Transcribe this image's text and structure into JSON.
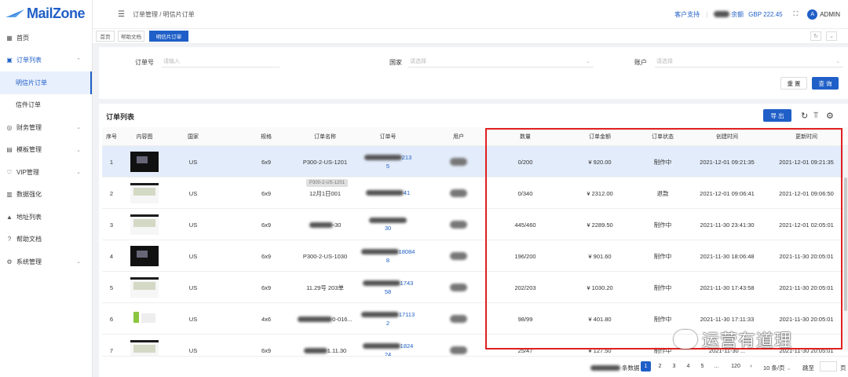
{
  "app": {
    "logo_text": "MailZone"
  },
  "sidebar": {
    "items": [
      {
        "icon": "grid-icon",
        "label": "首页",
        "chevron": false
      },
      {
        "icon": "calendar-icon",
        "label": "订单列表",
        "chevron": true,
        "open": true
      },
      {
        "icon": "none",
        "label": "明信片订单",
        "sub": true,
        "active": true
      },
      {
        "icon": "none",
        "label": "信件订单",
        "sub": true
      },
      {
        "icon": "dollar-icon",
        "label": "财务管理",
        "chevron": true
      },
      {
        "icon": "template-icon",
        "label": "模板管理",
        "chevron": true
      },
      {
        "icon": "vip-icon",
        "label": "VIP管理",
        "chevron": true
      },
      {
        "icon": "data-icon",
        "label": "数据强化",
        "chevron": false
      },
      {
        "icon": "address-icon",
        "label": "地址列表",
        "chevron": false
      },
      {
        "icon": "help-icon",
        "label": "帮助文档",
        "chevron": false
      },
      {
        "icon": "gear-icon",
        "label": "系统管理",
        "chevron": true
      }
    ]
  },
  "topbar": {
    "breadcrumb": "订单管理  /  明信片订单",
    "support": "客户支持",
    "balance_label": "余额",
    "balance_value": "GBP 222.45",
    "user": "ADMIN",
    "avatar_letter": "A"
  },
  "tabs": [
    "首页",
    "帮助文档",
    "明信片订单"
  ],
  "filters": {
    "order_no_label": "订单号",
    "order_no_placeholder": "请输入",
    "country_label": "国家",
    "country_placeholder": "请选择",
    "user_label": "账户",
    "user_placeholder": "请选择",
    "reset_label": "重 置",
    "search_label": "查 询"
  },
  "list": {
    "title": "订单列表",
    "export_label": "导 出",
    "columns": [
      "序号",
      "内容图",
      "国家",
      "规格",
      "订单名称",
      "订单号",
      "用户",
      "数量",
      "订单金额",
      "订单状态",
      "创建时间",
      "更新时间"
    ],
    "rows": [
      {
        "idx": "1",
        "thumb": "dark",
        "country": "US",
        "size": "6x9",
        "name": "P300-2-US-1201",
        "order_a": "213",
        "order_b": "5",
        "qty": "0/200",
        "amount": "¥ 920.00",
        "status": "制作中",
        "created": "2021-12-01 09:21:35",
        "updated": "2021-12-01 09:21:35"
      },
      {
        "idx": "2",
        "thumb": "light",
        "country": "US",
        "size": "6x9",
        "name": "12月1日001",
        "order_a": "41",
        "order_b": "",
        "qty": "0/340",
        "amount": "¥ 2312.00",
        "status": "退款",
        "created": "2021-12-01 09:06:41",
        "updated": "2021-12-01 09:06:50"
      },
      {
        "idx": "3",
        "thumb": "light",
        "country": "US",
        "size": "6x9",
        "name": "-30",
        "order_a": "",
        "order_b": "30",
        "qty": "445/460",
        "amount": "¥ 2289.50",
        "status": "制作中",
        "created": "2021-11-30 23:41:30",
        "updated": "2021-12-01 02:05:01"
      },
      {
        "idx": "4",
        "thumb": "dark",
        "country": "US",
        "size": "6x9",
        "name": "P300-2-US-1030",
        "order_a": "18084",
        "order_b": "8",
        "qty": "196/200",
        "amount": "¥ 901.60",
        "status": "制作中",
        "created": "2021-11-30 18:06:48",
        "updated": "2021-11-30 20:05:01"
      },
      {
        "idx": "5",
        "thumb": "light",
        "country": "US",
        "size": "6x9",
        "name": "11.29号 203单",
        "order_a": "1743",
        "order_b": "58",
        "qty": "202/203",
        "amount": "¥ 1030.20",
        "status": "制作中",
        "created": "2021-11-30 17:43:58",
        "updated": "2021-11-30 20:05:01"
      },
      {
        "idx": "6",
        "thumb": "green",
        "country": "US",
        "size": "4x6",
        "name": "0-016...",
        "order_a": "17113",
        "order_b": "2",
        "qty": "98/99",
        "amount": "¥ 401.80",
        "status": "制作中",
        "created": "2021-11-30 17:11:33",
        "updated": "2021-11-30 20:05:01"
      },
      {
        "idx": "7",
        "thumb": "light",
        "country": "US",
        "size": "6x9",
        "name": "1.11.30",
        "order_a": "1824",
        "order_b": "24",
        "qty": "25/47",
        "amount": "¥ 127.50",
        "status": "制作中",
        "created": "2021-11-30 ...",
        "updated": "2021-11-30 20:05:01"
      }
    ],
    "tooltip": "P300-2-US-1201"
  },
  "pagination": {
    "total_suffix": "条数据",
    "pages": [
      "1",
      "2",
      "3",
      "4",
      "5",
      "...",
      "120"
    ],
    "active_page": "1",
    "page_size": "10 条/页",
    "goto": "跳至",
    "page_suffix": "页"
  },
  "watermark": "运营有道理",
  "colors": {
    "brand": "#1f5fc7",
    "highlight": "#e02020",
    "row_selected": "#e3ecfa"
  }
}
